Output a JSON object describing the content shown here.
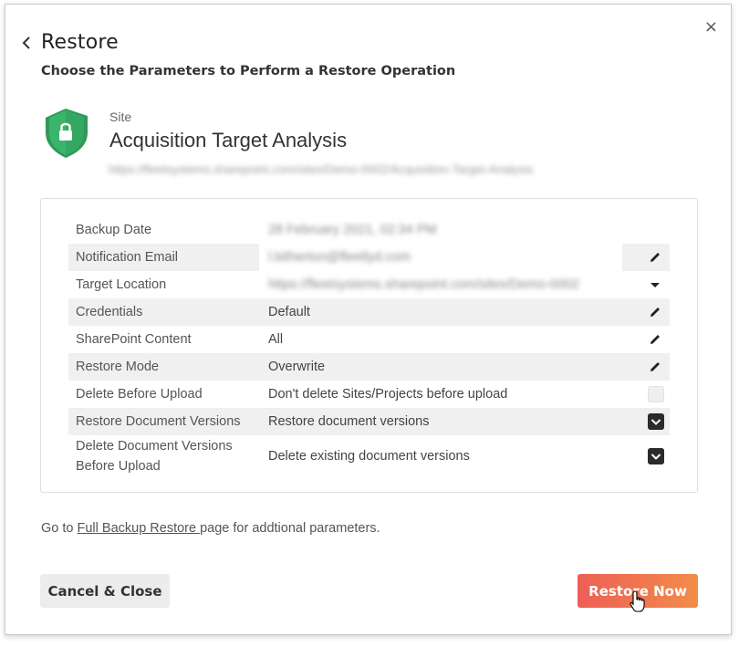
{
  "header": {
    "title": "Restore",
    "subtitle": "Choose the Parameters to Perform a Restore Operation",
    "close_glyph": "×",
    "back_icon": "chevron-left-icon"
  },
  "site": {
    "type_label": "Site",
    "name": "Acquisition Target Analysis",
    "url": "https://fleetsystems.sharepoint.com/sites/Demo-0002/Acquisition-Target-Analysis",
    "icon": "shield-lock-icon",
    "icon_color": "#3bb56b"
  },
  "params": {
    "rows": [
      {
        "label": "Backup Date",
        "value": "28 February 2021, 02:34 PM",
        "blurred": true,
        "shaded": false,
        "action": "none"
      },
      {
        "label": "Notification Email",
        "value": "l.bitherton@fleetlyd.com",
        "blurred": true,
        "shaded": true,
        "action": "edit"
      },
      {
        "label": "Target Location",
        "value": "https://fleetsystems.sharepoint.com/sites/Demo-0002",
        "blurred": true,
        "shaded": false,
        "action": "dropdown"
      },
      {
        "label": "Credentials",
        "value": "Default",
        "blurred": false,
        "shaded": true,
        "action": "edit"
      },
      {
        "label": "SharePoint Content",
        "value": "All",
        "blurred": false,
        "shaded": false,
        "action": "edit"
      },
      {
        "label": "Restore Mode",
        "value": "Overwrite",
        "blurred": false,
        "shaded": true,
        "action": "edit"
      },
      {
        "label": "Delete Before Upload",
        "value": "Don't delete Sites/Projects before upload",
        "blurred": false,
        "shaded": false,
        "action": "checkbox",
        "checked": false
      },
      {
        "label": "Restore Document Versions",
        "value": "Restore document versions",
        "blurred": false,
        "shaded": true,
        "action": "checkbox",
        "checked": true
      },
      {
        "label": "Delete Document Versions Before Upload",
        "value": "Delete existing document versions",
        "blurred": false,
        "shaded": false,
        "action": "checkbox",
        "checked": true
      }
    ]
  },
  "note": {
    "prefix": "Go to ",
    "link": "Full Backup Restore ",
    "suffix": "page for addtional parameters."
  },
  "buttons": {
    "cancel": "Cancel & Close",
    "restore": "Restore Now"
  },
  "colors": {
    "restore_gradient_start": "#ed5f56",
    "restore_gradient_end": "#f28c4a",
    "checkbox_checked": "#2b2b2b"
  }
}
